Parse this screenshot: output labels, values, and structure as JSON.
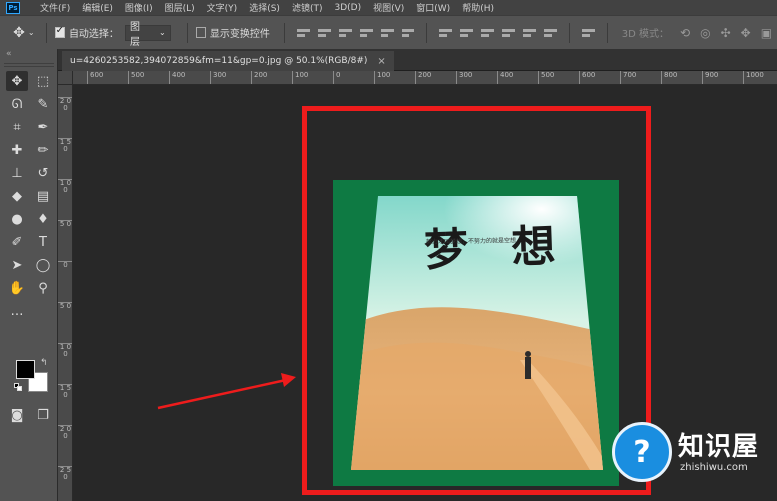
{
  "app": {
    "logo_text": "Ps"
  },
  "menu": [
    "文件(F)",
    "编辑(E)",
    "图像(I)",
    "图层(L)",
    "文字(Y)",
    "选择(S)",
    "滤镜(T)",
    "3D(D)",
    "视图(V)",
    "窗口(W)",
    "帮助(H)"
  ],
  "options": {
    "auto_select_label": "自动选择：",
    "auto_select_checked": true,
    "layer_select_value": "图层",
    "show_transform_label": "显示变换控件",
    "show_transform_checked": false,
    "mode_3d_label": "3D 模式："
  },
  "panel_collapse": "«",
  "document_tab": {
    "title": "u=4260253582,394072859&fm=11&gp=0.jpg @ 50.1%(RGB/8#)",
    "close": "×"
  },
  "ruler_h": [
    "600",
    "500",
    "400",
    "300",
    "200",
    "100",
    "0",
    "100",
    "200",
    "300",
    "400",
    "500",
    "600",
    "700",
    "800",
    "900",
    "1000"
  ],
  "ruler_v": [
    "2 0 0",
    "1 5 0",
    "1 0 0",
    "5 0",
    "0",
    "5 0",
    "1 0 0",
    "1 5 0",
    "2 0 0",
    "2 5 0",
    "3 0 0",
    "3 5 0",
    "4 0 0",
    "4 5 0",
    "5 0 0",
    "5 5 0",
    "6 0 0",
    "6 5 0",
    "7 0 0"
  ],
  "poster": {
    "headline": "梦 想",
    "subline": "努力才叫梦想，不努力的就是空想"
  },
  "colors": {
    "highlight": "#ee1c1c",
    "canvas_green": "#0e7a43",
    "foreground": "#000000",
    "background": "#ffffff"
  },
  "watermark": {
    "title": "知识屋",
    "url": "zhishiwu.com"
  }
}
